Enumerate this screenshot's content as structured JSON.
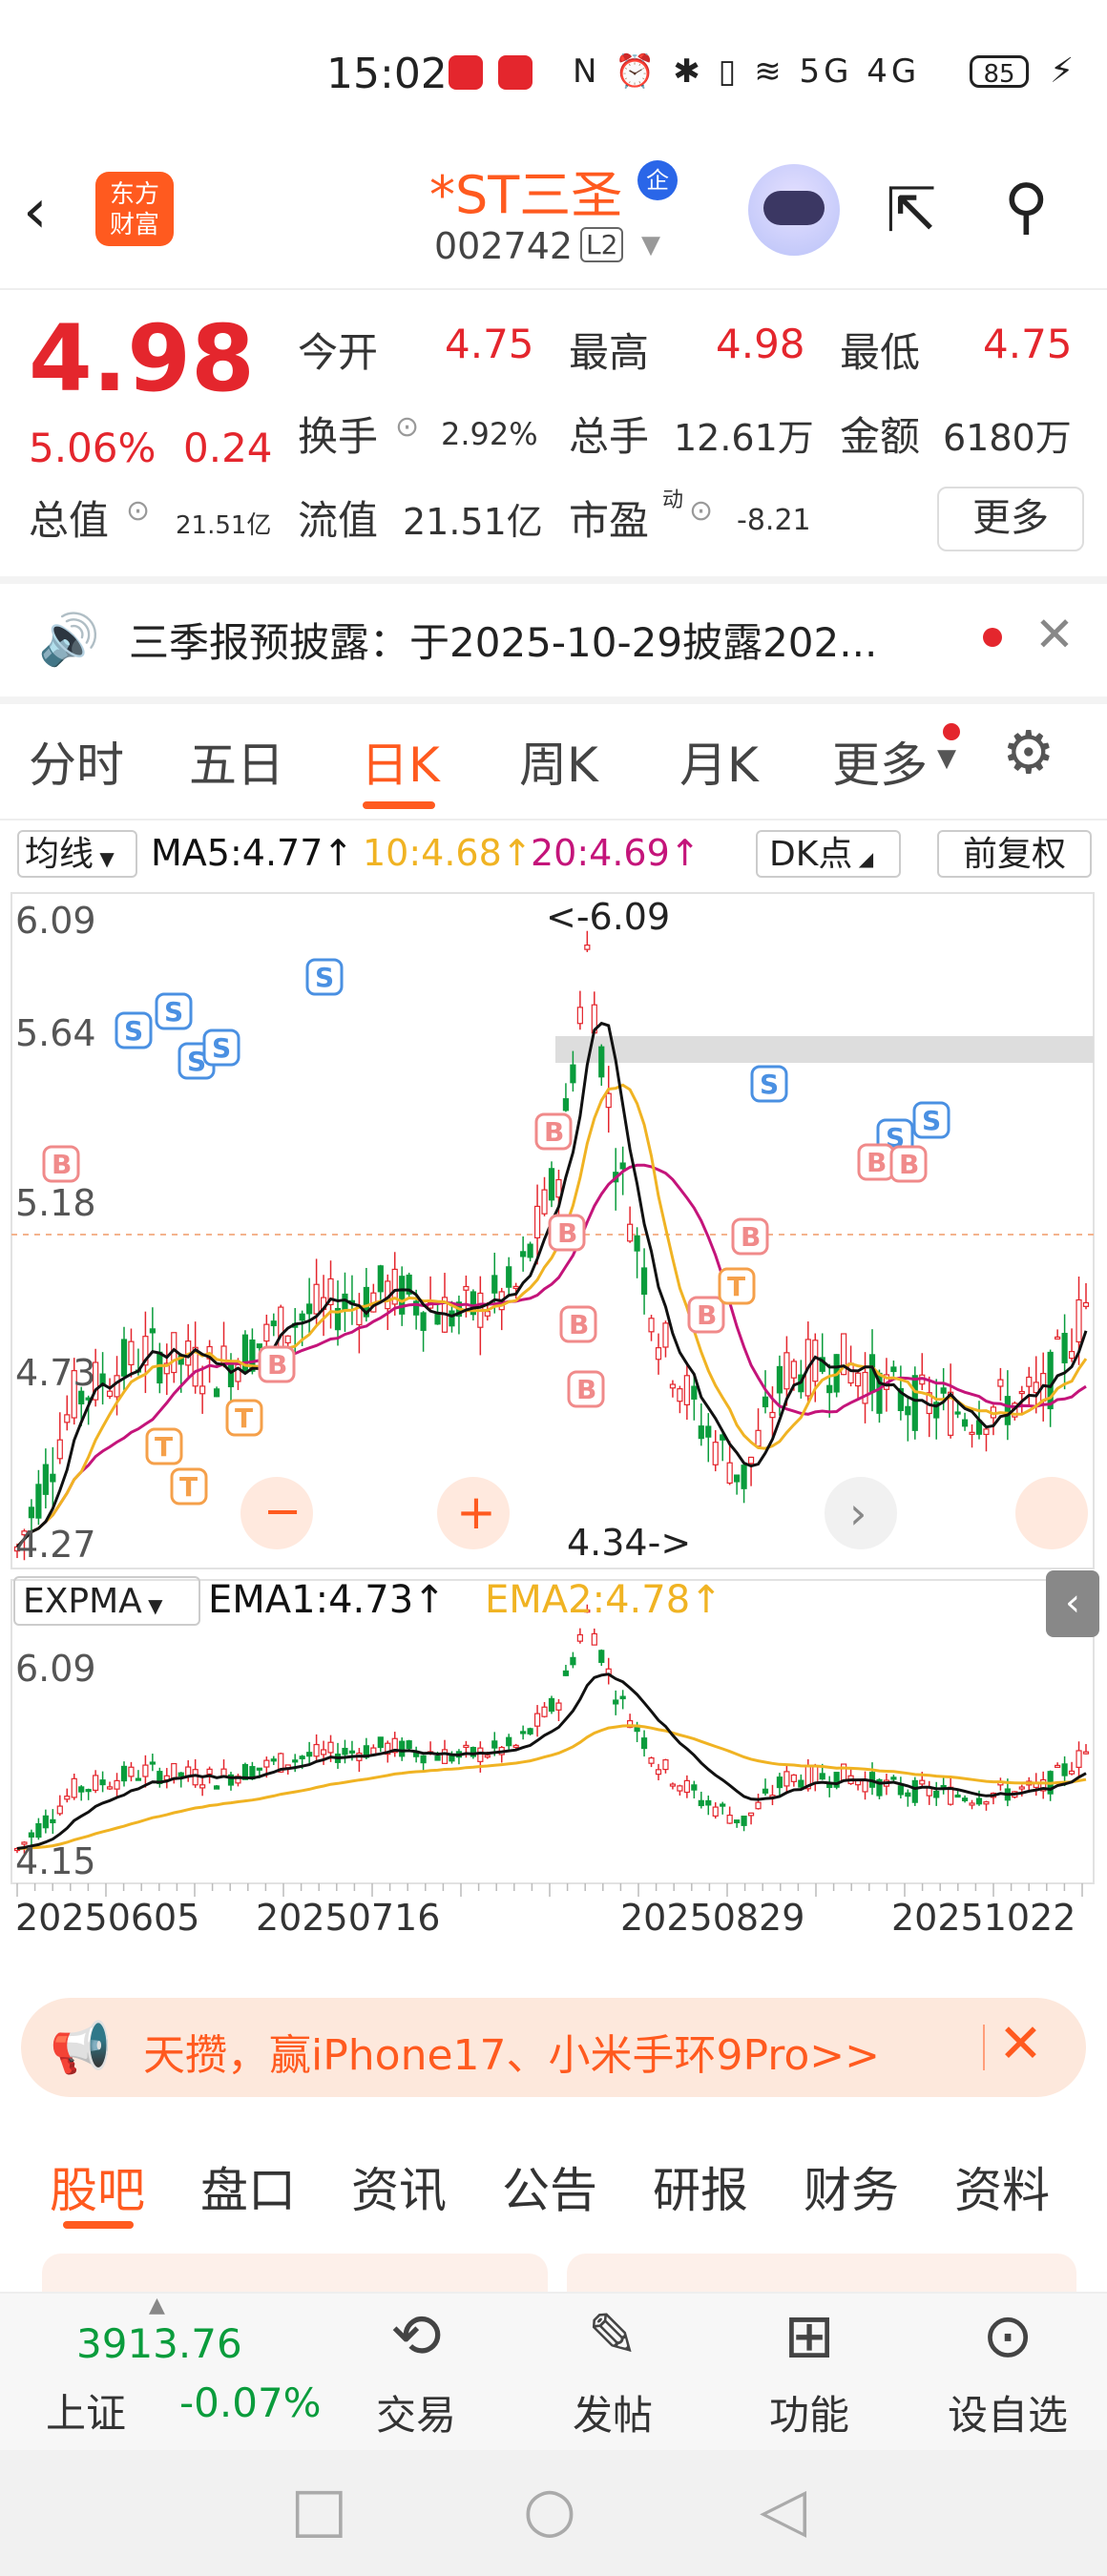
{
  "status_bar": {
    "time": "15:02",
    "battery": "85",
    "icons": "N ⏰ ✱ ▯ ≋ 5G 4G"
  },
  "header": {
    "stock_name": "*ST三圣",
    "badge": "企",
    "stock_code": "002742",
    "level": "L2",
    "logo_line1": "东方",
    "logo_line2": "财富"
  },
  "quote": {
    "price": "4.98",
    "change_pct": "5.06%",
    "change": "0.24",
    "open_label": "今开",
    "open": "4.75",
    "high_label": "最高",
    "high": "4.98",
    "low_label": "最低",
    "low": "4.75",
    "turnover_label": "换手",
    "turnover": "2.92%",
    "volume_label": "总手",
    "volume": "12.61万",
    "amount_label": "金额",
    "amount": "6180万",
    "mcap_label": "总值",
    "mcap": "21.51亿",
    "float_label": "流值",
    "float": "21.51亿",
    "pe_label": "市盈",
    "pe_sup": "动",
    "pe": "-8.21",
    "more_label": "更多"
  },
  "notice": {
    "text": "三季报预披露：于2025-10-29披露202..."
  },
  "tabs": [
    {
      "label": "分时"
    },
    {
      "label": "五日"
    },
    {
      "label": "日K"
    },
    {
      "label": "周K"
    },
    {
      "label": "月K"
    },
    {
      "label": "更多"
    }
  ],
  "ma_bar": {
    "selector": "均线",
    "ma5": "MA5:4.77↑",
    "ma10": "10:4.68↑",
    "ma20": "20:4.69↑",
    "dk": "DK点",
    "fq": "前复权"
  },
  "kline": {
    "y_top": "6.09",
    "y_2": "5.64",
    "y_3": "5.18",
    "y_4": "4.73",
    "y_low": "4.27",
    "peak_label": "<-6.09",
    "low_label": "4.34->",
    "colors": {
      "up": "#e4262d",
      "down": "#0a9c3c",
      "ma5": "#111111",
      "ma10": "#f0b323",
      "ma20": "#c4147a"
    }
  },
  "ema_bar": {
    "selector": "EXPMA",
    "ema1": "EMA1:4.73↑",
    "ema2": "EMA2:4.78↑",
    "y_top": "6.09",
    "y_low": "4.15"
  },
  "dates": [
    "20250605",
    "20250716",
    "20250829",
    "20251022"
  ],
  "banner": {
    "text": "天攒，赢iPhone17、小米手环9Pro>>"
  },
  "sub_tabs": [
    {
      "label": "股吧"
    },
    {
      "label": "盘口"
    },
    {
      "label": "资讯"
    },
    {
      "label": "公告"
    },
    {
      "label": "研报"
    },
    {
      "label": "财务"
    },
    {
      "label": "资料"
    }
  ],
  "bottom_nav": {
    "index_value": "3913.76",
    "index_name": "上证",
    "index_change": "-0.07%",
    "items": [
      {
        "label": "交易",
        "icon": "yen-cycle-icon"
      },
      {
        "label": "发帖",
        "icon": "edit-icon"
      },
      {
        "label": "功能",
        "icon": "grid-icon"
      },
      {
        "label": "设自选",
        "icon": "more-icon"
      }
    ]
  }
}
